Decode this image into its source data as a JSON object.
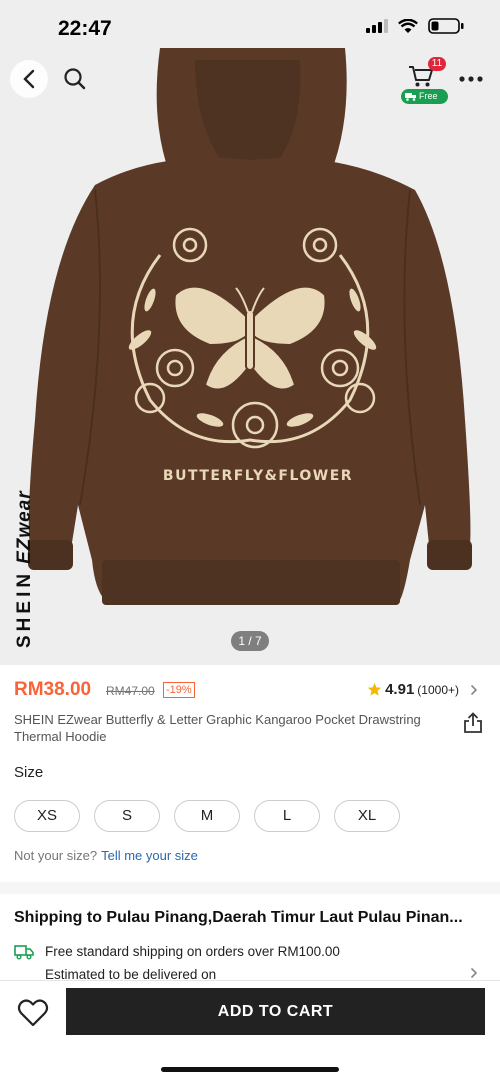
{
  "status_bar": {
    "time": "22:47"
  },
  "header": {
    "cart_badge": "11",
    "free_label": "Free",
    "back_icon": "chevron-left-icon",
    "search_icon": "search-icon",
    "cart_icon": "cart-icon",
    "more_icon": "more-horizontal-icon"
  },
  "gallery": {
    "print_text": "BUTTERFLY&FLOWER",
    "brand_vertical_1": "SHEIN",
    "brand_vertical_2": "EZwear",
    "page_indicator": "1 / 7",
    "colors": {
      "hoodie": "#5a3a27",
      "print": "#e8d8b8",
      "background": "#eeeeee"
    }
  },
  "product": {
    "price": "RM38.00",
    "original_price": "RM47.00",
    "discount": "-19%",
    "rating": "4.91",
    "rating_count": "(1000+)",
    "title": "SHEIN EZwear Butterfly & Letter Graphic Kangaroo Pocket Drawstring Thermal Hoodie",
    "accent_color": "#fa6338"
  },
  "size": {
    "label": "Size",
    "options": [
      "XS",
      "S",
      "M",
      "L",
      "XL"
    ],
    "hint_text": "Not your size?",
    "hint_link": "Tell me your size"
  },
  "shipping": {
    "title": "Shipping to Pulau Pinang,Daerah Timur Laut Pulau Pinan...",
    "free_line": "Free standard shipping on orders over RM100.00",
    "estimate_line": "Estimated to be delivered on"
  },
  "bottom_bar": {
    "add_to_cart": "ADD TO CART",
    "wishlist_icon": "heart-icon"
  }
}
